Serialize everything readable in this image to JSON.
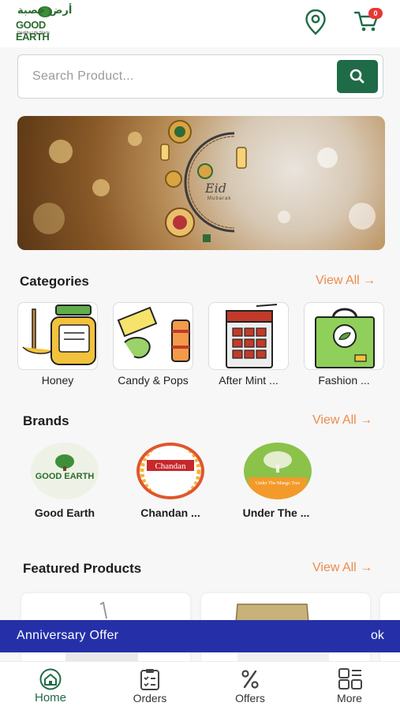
{
  "header": {
    "logo_arabic": "أرض خصبة",
    "logo_english": "GOOD EARTH",
    "logo_tagline": "Healthy Life Starts",
    "location_icon": "location-pin-icon",
    "cart_icon": "shopping-cart-icon",
    "cart_count": "0"
  },
  "search": {
    "placeholder": "Search Product...",
    "button_icon": "search-icon"
  },
  "banner": {
    "title": "Eid",
    "subtitle": "Mubarak"
  },
  "categories": {
    "title": "Categories",
    "view_all": "View All",
    "items": [
      {
        "label": "Honey",
        "icon": "honey-jar-icon"
      },
      {
        "label": "Candy & Pops",
        "icon": "candy-icon"
      },
      {
        "label": "After Mint ...",
        "icon": "mint-box-icon"
      },
      {
        "label": "Fashion ...",
        "icon": "eco-bag-icon"
      }
    ]
  },
  "brands": {
    "title": "Brands",
    "view_all": "View All",
    "items": [
      {
        "label": "Good Earth",
        "logo_text": "GOOD EARTH"
      },
      {
        "label": "Chandan ...",
        "logo_text": "Chandan"
      },
      {
        "label": "Under The ...",
        "logo_text": "Under The Mango Tree"
      }
    ]
  },
  "featured": {
    "title": "Featured Products",
    "view_all": "View All"
  },
  "offer_bar": {
    "text": "Anniversary Offer",
    "action": "ok"
  },
  "nav": {
    "items": [
      {
        "label": "Home",
        "icon": "home-icon",
        "active": true
      },
      {
        "label": "Orders",
        "icon": "orders-clipboard-icon"
      },
      {
        "label": "Offers",
        "icon": "percent-icon"
      },
      {
        "label": "More",
        "icon": "grid-menu-icon"
      }
    ]
  },
  "colors": {
    "primary": "#1f6b47",
    "accent": "#ef8a4a",
    "offer_bar": "#2530a8",
    "badge": "#e53935"
  }
}
